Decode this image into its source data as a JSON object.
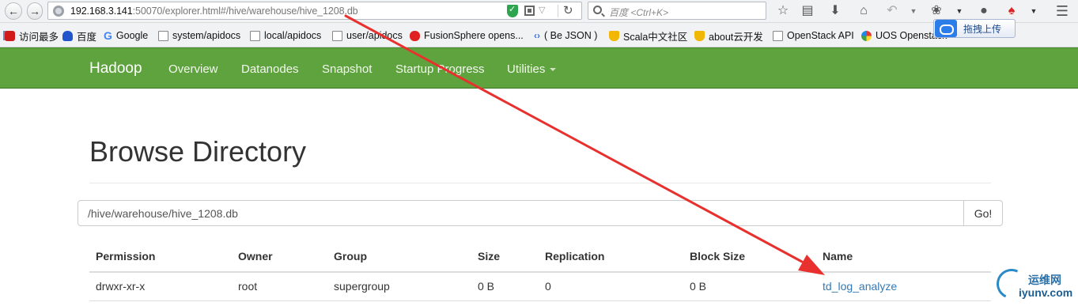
{
  "browser": {
    "url_host": "192.168.3.141",
    "url_rest": ":50070/explorer.html#/hive/warehouse/hive_1208.db",
    "search_placeholder": "百度 <Ctrl+K>",
    "upload_label": "拖拽上传"
  },
  "bookmarks": [
    {
      "label": "访问最多",
      "icon": "red-square-icon"
    },
    {
      "label": "百度",
      "icon": "paw-icon"
    },
    {
      "label": "Google",
      "icon": "google-icon"
    },
    {
      "label": "system/apidocs",
      "icon": "page-icon"
    },
    {
      "label": "local/apidocs",
      "icon": "page-icon"
    },
    {
      "label": "user/apidocs",
      "icon": "page-icon"
    },
    {
      "label": "FusionSphere opens...",
      "icon": "huawei-icon"
    },
    {
      "label": "( Be JSON )",
      "icon": "json-icon"
    },
    {
      "label": "Scala中文社区",
      "icon": "cup-icon"
    },
    {
      "label": "about云开发",
      "icon": "cup-icon"
    },
    {
      "label": "OpenStack API",
      "icon": "page-icon"
    },
    {
      "label": "UOS Openstack",
      "icon": "multicolor-icon"
    }
  ],
  "navbar": {
    "brand": "Hadoop",
    "items": [
      "Overview",
      "Datanodes",
      "Snapshot",
      "Startup Progress",
      "Utilities"
    ]
  },
  "page": {
    "title": "Browse Directory",
    "path_value": "/hive/warehouse/hive_1208.db",
    "go_label": "Go!"
  },
  "table": {
    "columns": [
      "Permission",
      "Owner",
      "Group",
      "Size",
      "Replication",
      "Block Size",
      "Name"
    ],
    "rows": [
      [
        "drwxr-xr-x",
        "root",
        "supergroup",
        "0 B",
        "0",
        "0 B",
        "td_log_analyze"
      ]
    ]
  },
  "watermark": {
    "top": "运维网",
    "bottom": "iyunv.com"
  },
  "colors": {
    "navbar": "#5fa33e",
    "link": "#337ab7",
    "arrow": "#e8312f"
  }
}
